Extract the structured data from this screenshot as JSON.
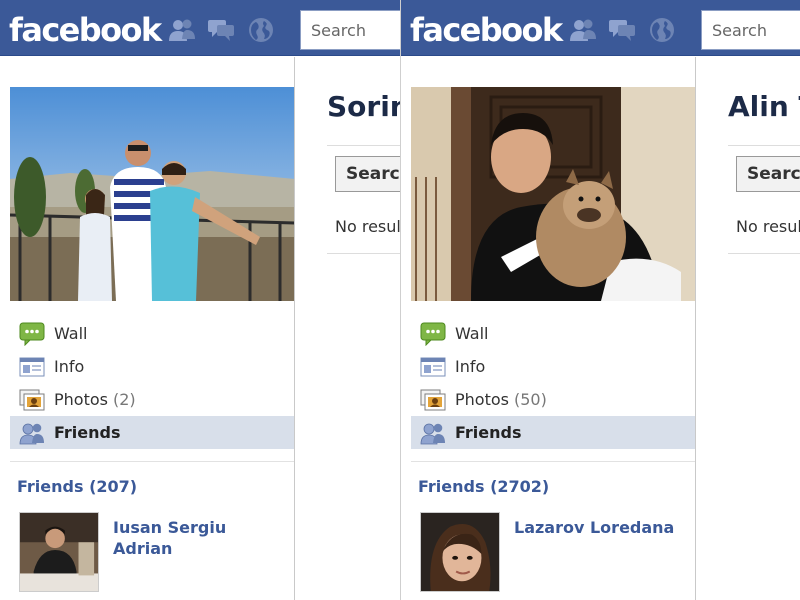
{
  "brand": {
    "logo_text": "facebook",
    "color": "#3b5998"
  },
  "panels": [
    {
      "search_placeholder": "Search",
      "profile_name": "Sorin",
      "search_button": "Search",
      "no_results": "No results",
      "menu": [
        {
          "label": "Wall",
          "icon": "wall-icon",
          "count": ""
        },
        {
          "label": "Info",
          "icon": "info-icon",
          "count": ""
        },
        {
          "label": "Photos",
          "icon": "photos-icon",
          "count": "(2)"
        },
        {
          "label": "Friends",
          "icon": "friends-icon",
          "count": "",
          "active": true
        }
      ],
      "friends_heading": "Friends (207)",
      "friend_name": "Iusan Sergiu Adrian"
    },
    {
      "search_placeholder": "Search",
      "profile_name": "Alin T",
      "search_button": "Search",
      "no_results": "No results",
      "menu": [
        {
          "label": "Wall",
          "icon": "wall-icon",
          "count": ""
        },
        {
          "label": "Info",
          "icon": "info-icon",
          "count": ""
        },
        {
          "label": "Photos",
          "icon": "photos-icon",
          "count": "(50)"
        },
        {
          "label": "Friends",
          "icon": "friends-icon",
          "count": "",
          "active": true
        }
      ],
      "friends_heading": "Friends (2702)",
      "friend_name": "Lazarov Loredana"
    }
  ]
}
